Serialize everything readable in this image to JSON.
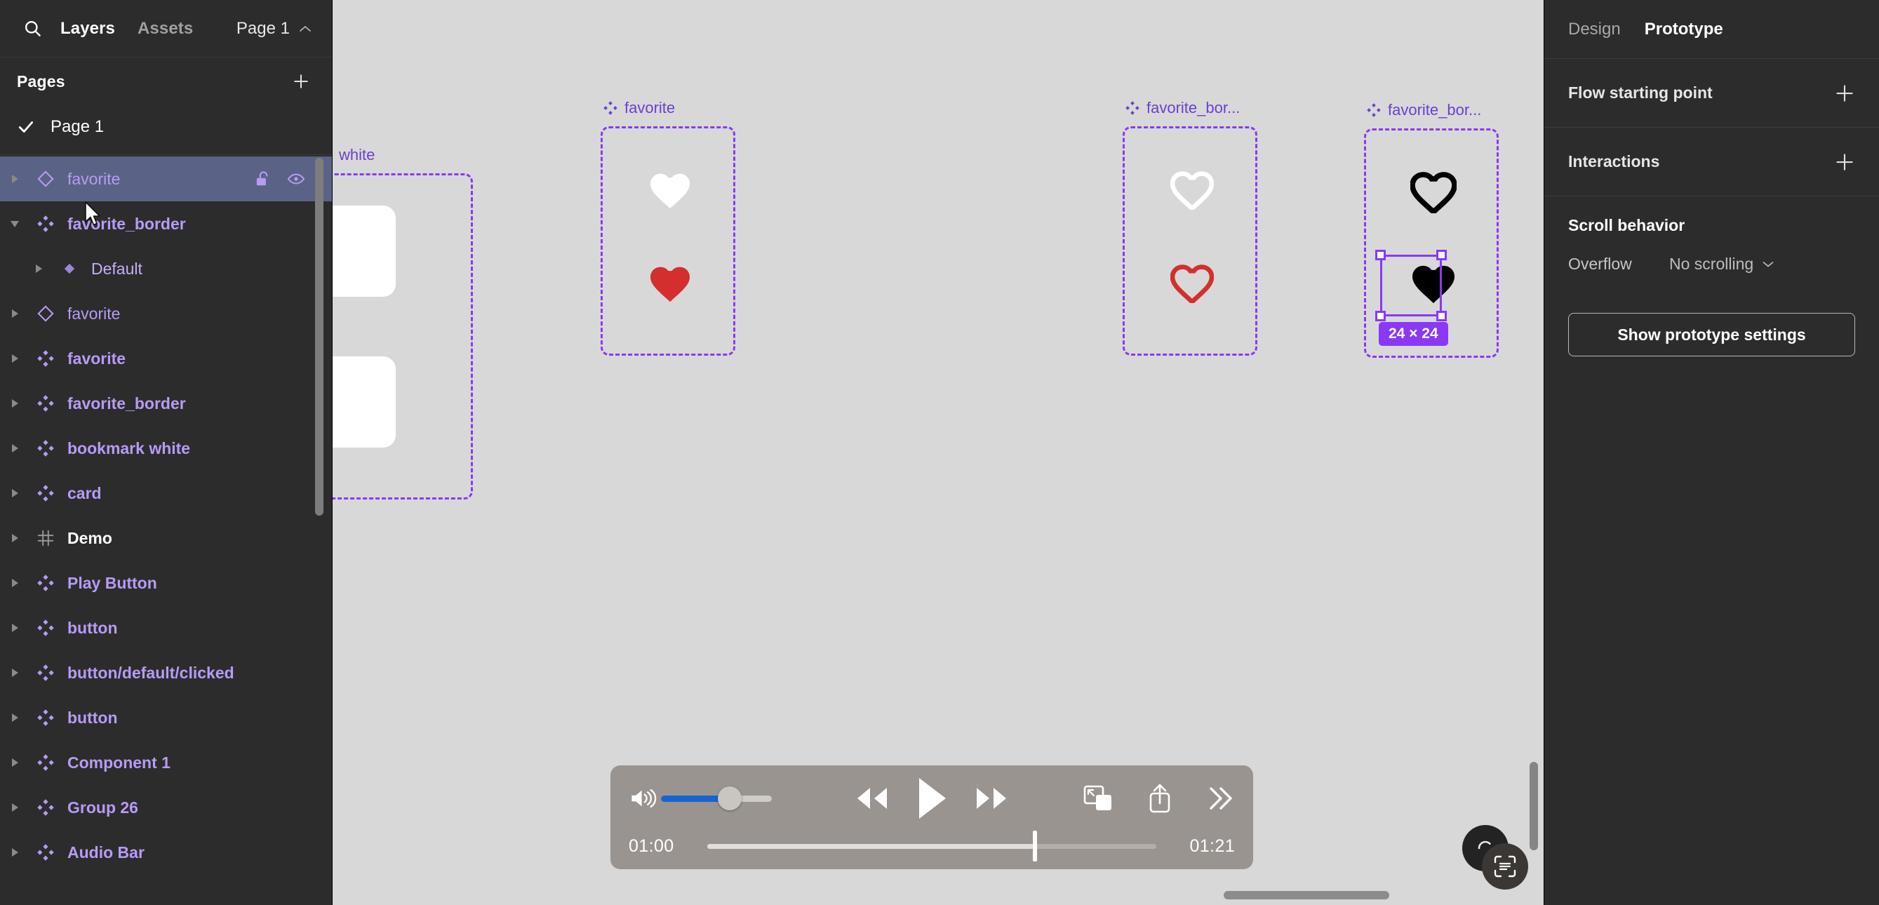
{
  "left_panel": {
    "search_icon": "search-icon",
    "tabs": [
      {
        "label": "Layers",
        "active": true
      },
      {
        "label": "Assets",
        "active": false
      }
    ],
    "page_selector": {
      "label": "Page 1",
      "icon": "chevron-up-icon"
    },
    "pages": {
      "title": "Pages",
      "add_icon": "plus-icon",
      "items": [
        {
          "label": "Page 1",
          "selected": true,
          "icon": "check-icon"
        }
      ]
    },
    "layers": [
      {
        "label": "favorite",
        "type": "instance",
        "caret": "right",
        "indent": 0,
        "selected": true,
        "lock_icon": "unlock-icon",
        "eye_icon": "eye-icon"
      },
      {
        "label": "favorite_border",
        "type": "component",
        "caret": "down",
        "indent": 0,
        "selected": false
      },
      {
        "label": "Default",
        "type": "variant",
        "caret": "right",
        "indent": 1,
        "selected": false
      },
      {
        "label": "favorite",
        "type": "instance",
        "caret": "right",
        "indent": 0,
        "selected": false
      },
      {
        "label": "favorite",
        "type": "component",
        "caret": "right",
        "indent": 0,
        "selected": false
      },
      {
        "label": "favorite_border",
        "type": "component",
        "caret": "right",
        "indent": 0,
        "selected": false
      },
      {
        "label": "bookmark white",
        "type": "component",
        "caret": "right",
        "indent": 0,
        "selected": false
      },
      {
        "label": "card",
        "type": "component",
        "caret": "right",
        "indent": 0,
        "selected": false
      },
      {
        "label": "Demo",
        "type": "frame",
        "caret": "right",
        "indent": 0,
        "selected": false
      },
      {
        "label": "Play Button",
        "type": "component",
        "caret": "right",
        "indent": 0,
        "selected": false
      },
      {
        "label": "button",
        "type": "component",
        "caret": "right",
        "indent": 0,
        "selected": false
      },
      {
        "label": "button/default/clicked",
        "type": "component",
        "caret": "right",
        "indent": 0,
        "selected": false
      },
      {
        "label": "button",
        "type": "component",
        "caret": "right",
        "indent": 0,
        "selected": false
      },
      {
        "label": "Component 1",
        "type": "component",
        "caret": "right",
        "indent": 0,
        "selected": false
      },
      {
        "label": "Group 26",
        "type": "component",
        "caret": "right",
        "indent": 0,
        "selected": false
      },
      {
        "label": "Audio Bar",
        "type": "component",
        "caret": "right",
        "indent": 0,
        "selected": false
      }
    ]
  },
  "canvas": {
    "component_sets": [
      {
        "label": "bookmark white",
        "truncated_label": "white",
        "hearts": []
      },
      {
        "label": "favorite",
        "truncated_label": "favorite",
        "hearts": [
          "white-filled-heart",
          "red-filled-heart"
        ]
      },
      {
        "label": "favorite_border",
        "truncated_label": "favorite_bor...",
        "hearts": [
          "white-outline-heart",
          "red-outline-heart"
        ]
      },
      {
        "label": "favorite_border",
        "truncated_label": "favorite_bor...",
        "hearts": [
          "black-outline-heart",
          "black-filled-heart"
        ]
      }
    ],
    "selection": {
      "size_badge": "24 × 24",
      "accent_color": "#8a38f5"
    },
    "highlighted_instance": {
      "icon": "black-filled-heart",
      "accent_color": "#8a38f5"
    },
    "background_color": "#d8d8d8"
  },
  "player": {
    "volume": {
      "icon": "volume-high-icon",
      "level_percent": 62,
      "fill_color": "#1863cf"
    },
    "controls": [
      {
        "name": "rewind-button",
        "icon": "rewind-icon"
      },
      {
        "name": "play-button",
        "icon": "play-icon"
      },
      {
        "name": "fast-forward-button",
        "icon": "fast-forward-icon"
      }
    ],
    "right_controls": [
      {
        "name": "picture-in-picture-button",
        "icon": "picture-in-picture-icon"
      },
      {
        "name": "share-button",
        "icon": "share-icon"
      },
      {
        "name": "more-button",
        "icon": "chevron-double-right-icon"
      }
    ],
    "current_time": "01:00",
    "total_time": "01:21",
    "progress_percent": 73
  },
  "right_panel": {
    "tabs": [
      {
        "label": "Design",
        "active": false
      },
      {
        "label": "Prototype",
        "active": true
      }
    ],
    "sections": [
      {
        "title": "Flow starting point",
        "add_icon": "plus-icon"
      },
      {
        "title": "Interactions",
        "add_icon": "plus-icon"
      }
    ],
    "scroll_behavior": {
      "title": "Scroll behavior",
      "overflow_label": "Overflow",
      "overflow_value": "No scrolling",
      "overflow_icon": "chevron-down-icon"
    },
    "prototype_settings_button": "Show prototype settings"
  },
  "overlays": {
    "fab_back": "spinner-icon",
    "fab_front": "scan-text-icon"
  }
}
